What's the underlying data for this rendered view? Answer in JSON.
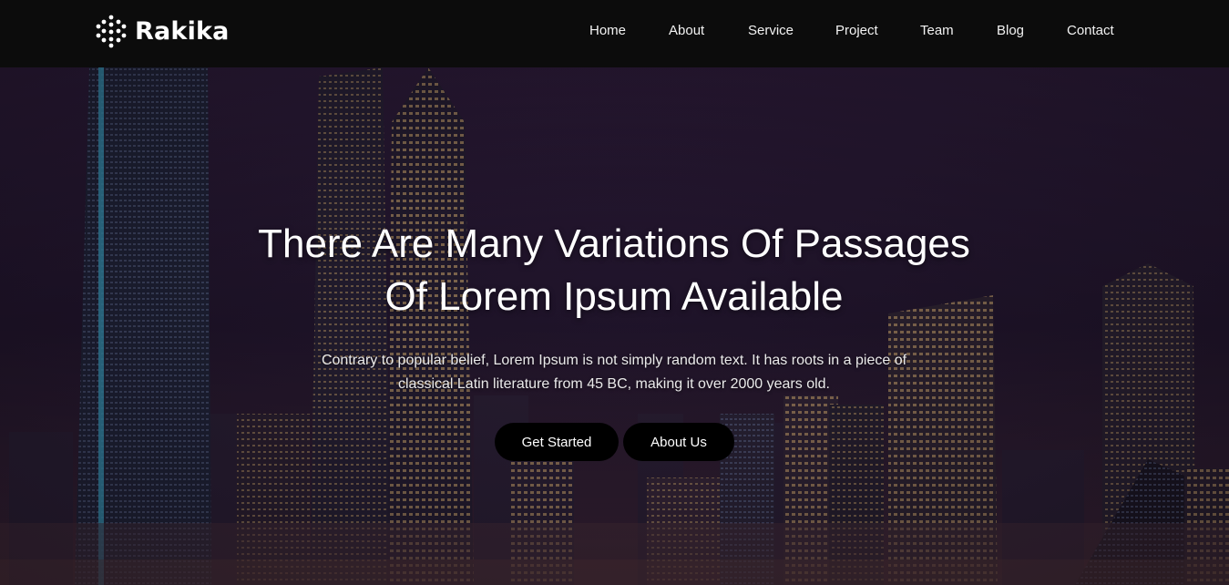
{
  "brand": {
    "name": "Rakika",
    "logo_icon": "hexagon-dots-icon"
  },
  "nav": {
    "items": [
      {
        "label": "Home"
      },
      {
        "label": "About"
      },
      {
        "label": "Service"
      },
      {
        "label": "Project"
      },
      {
        "label": "Team"
      },
      {
        "label": "Blog"
      },
      {
        "label": "Contact"
      }
    ]
  },
  "hero": {
    "title_line1": "There Are Many Variations Of Passages",
    "title_line2": "Of Lorem Ipsum Available",
    "subtitle_line1": "Contrary to popular belief, Lorem Ipsum is not simply random text. It has roots in a piece of",
    "subtitle_line2": "classical Latin literature from 45 BC, making it over 2000 years old.",
    "primary_button": "Get Started",
    "secondary_button": "About Us"
  },
  "colors": {
    "header_bg": "#0c0c0c",
    "button_bg": "#000000",
    "text": "#ffffff"
  }
}
